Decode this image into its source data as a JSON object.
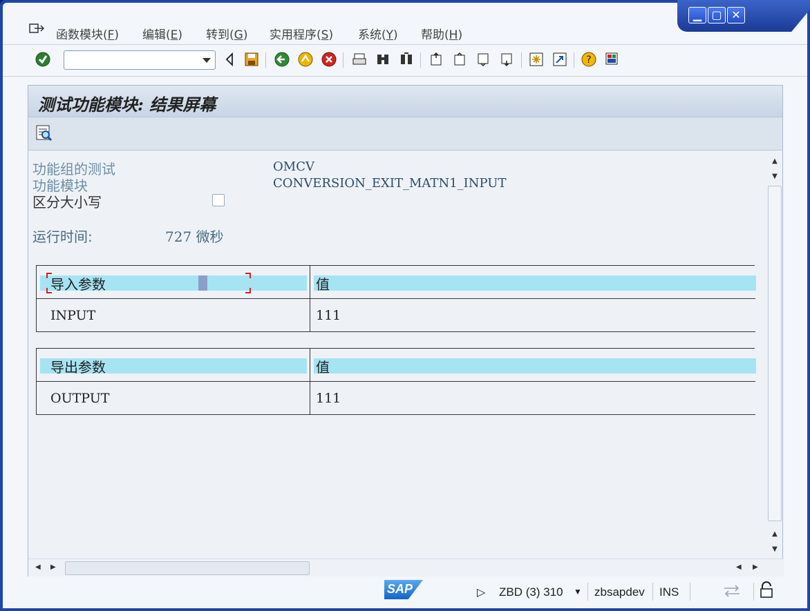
{
  "menu": {
    "items": [
      {
        "label": "函数模块(",
        "key": "F",
        "end": ")"
      },
      {
        "label": "编辑(",
        "key": "E",
        "end": ")"
      },
      {
        "label": "转到(",
        "key": "G",
        "end": ")"
      },
      {
        "label": "实用程序(",
        "key": "S",
        "end": ")"
      },
      {
        "label": "系统(",
        "key": "Y",
        "end": ")"
      },
      {
        "label": "帮助(",
        "key": "H",
        "end": ")"
      }
    ]
  },
  "command_field": {
    "value": ""
  },
  "screen": {
    "title": "测试功能模块: 结果屏幕"
  },
  "fields": {
    "function_group_label": "功能组的测试",
    "function_group_value": "OMCV",
    "function_module_label": "功能模块",
    "function_module_value": "CONVERSION_EXIT_MATN1_INPUT",
    "case_sensitive_label": "区分大小写",
    "case_sensitive_checked": false,
    "runtime_label": "运行时间:",
    "runtime_value": "727 微秒"
  },
  "import_table": {
    "headers": [
      "导入参数",
      "值"
    ],
    "rows": [
      [
        "INPUT",
        "111"
      ]
    ]
  },
  "export_table": {
    "headers": [
      "导出参数",
      "值"
    ],
    "rows": [
      [
        "OUTPUT",
        "111"
      ]
    ]
  },
  "status": {
    "system": "ZBD (3) 310",
    "server": "zbsapdev",
    "mode": "INS"
  },
  "colors": {
    "header_fill": "#a6e3f3",
    "frame": "#1f46a8",
    "focus": "#d02020"
  },
  "icons": [
    "enter-icon",
    "back-icon",
    "save-icon",
    "back-green-icon",
    "exit-icon",
    "cancel-icon",
    "print-icon",
    "find-icon",
    "find-next-icon",
    "first-page-icon",
    "prev-page-icon",
    "next-page-icon",
    "last-page-icon",
    "new-session-icon",
    "shortcut-icon",
    "help-icon",
    "layout-icon",
    "detail-view-icon",
    "lock-icon"
  ]
}
